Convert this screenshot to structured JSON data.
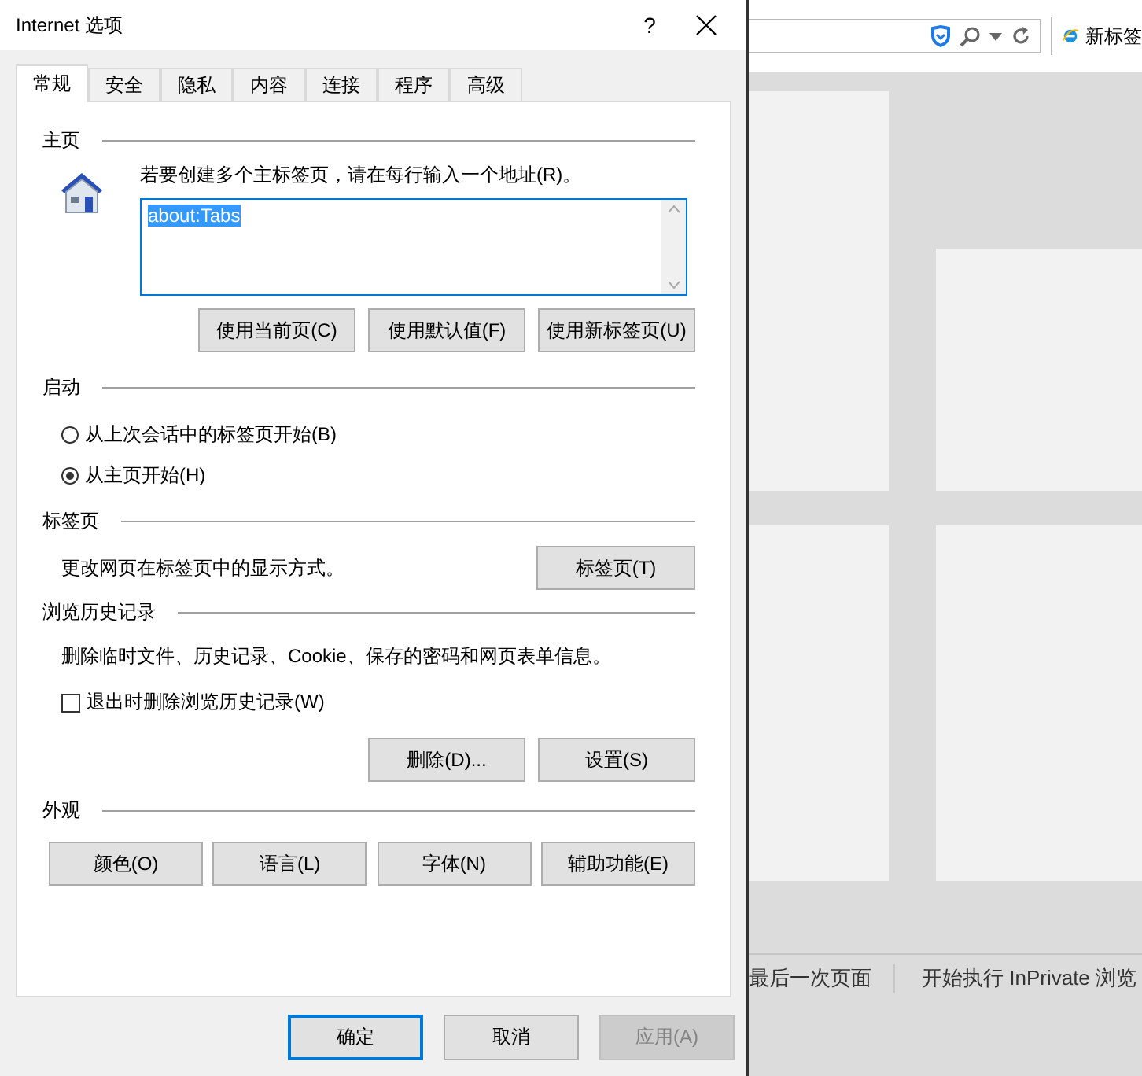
{
  "dialog": {
    "title": "Internet 选项",
    "help": "?",
    "tabs": [
      {
        "label": "常规",
        "selected": true
      },
      {
        "label": "安全",
        "selected": false
      },
      {
        "label": "隐私",
        "selected": false
      },
      {
        "label": "内容",
        "selected": false
      },
      {
        "label": "连接",
        "selected": false
      },
      {
        "label": "程序",
        "selected": false
      },
      {
        "label": "高级",
        "selected": false
      }
    ],
    "home": {
      "heading": "主页",
      "instruction": "若要创建多个主标签页，请在每行输入一个地址(R)。",
      "value": "about:Tabs",
      "buttons": [
        "使用当前页(C)",
        "使用默认值(F)",
        "使用新标签页(U)"
      ]
    },
    "startup": {
      "heading": "启动",
      "options": [
        {
          "label": "从上次会话中的标签页开始(B)",
          "selected": false
        },
        {
          "label": "从主页开始(H)",
          "selected": true
        }
      ]
    },
    "tab_settings": {
      "heading": "标签页",
      "description": "更改网页在标签页中的显示方式。",
      "button": "标签页(T)"
    },
    "history": {
      "heading": "浏览历史记录",
      "description": "删除临时文件、历史记录、Cookie、保存的密码和网页表单信息。",
      "checkbox": {
        "label": "退出时删除浏览历史记录(W)",
        "checked": false
      },
      "buttons": [
        "删除(D)...",
        "设置(S)"
      ]
    },
    "appearance": {
      "heading": "外观",
      "buttons": [
        "颜色(O)",
        "语言(L)",
        "字体(N)",
        "辅助功能(E)"
      ]
    },
    "footer": [
      {
        "label": "确定",
        "kind": "default"
      },
      {
        "label": "取消",
        "kind": "normal"
      },
      {
        "label": "应用(A)",
        "kind": "disabled"
      }
    ]
  },
  "browser": {
    "tab_title": "新标签",
    "recent": "最后一次页面",
    "inprivate": "开始执行 InPrivate 浏览"
  }
}
